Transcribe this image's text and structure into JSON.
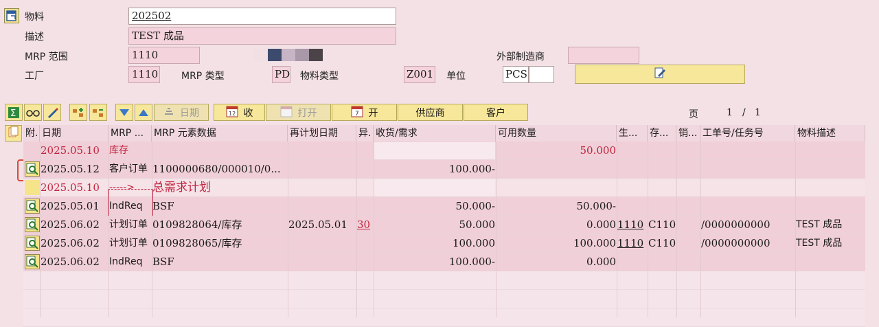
{
  "header": {
    "material_label": "物料",
    "material_value": "202502",
    "desc_label": "描述",
    "desc_value": "TEST 成品",
    "mrp_area_label": "MRP 范围",
    "mrp_area_value": "1110",
    "ext_mfr_label": "外部制造商",
    "ext_mfr_value": "",
    "plant_label": "工厂",
    "plant_value": "1110",
    "mrp_type_label": "MRP 类型",
    "mrp_type_value": "PD",
    "mat_type_label": "物料类型",
    "mat_type_value": "Z001",
    "unit_label": "单位",
    "unit_value": "PCS",
    "unit_extra": ""
  },
  "toolbar": {
    "date_label": "日期",
    "receipt_label": "收",
    "open_label": "打开",
    "open2_label": "开",
    "supplier_label": "供应商",
    "customer_label": "客户",
    "page_label": "页",
    "page_current": "1",
    "page_sep": "/",
    "page_total": "1"
  },
  "grid": {
    "columns": [
      "附.",
      "日期",
      "MRP ...",
      "MRP 元素数据",
      "再计划日期",
      "异.",
      "收货/需求",
      "可用数量",
      "生...",
      "存...",
      "销...",
      "工单号/任务号",
      "物料描述"
    ],
    "rows": [
      {
        "date": "2025.05.10",
        "mrp": "库存",
        "data": "",
        "resched": "",
        "exc": "",
        "qty": "",
        "avail": "50.000",
        "prod": "",
        "stor": "",
        "sales": "",
        "order": "",
        "desc": "",
        "style": "red",
        "icon": false
      },
      {
        "date": "2025.05.12",
        "mrp": "客户订单",
        "data": "1100000680/000010/0...",
        "resched": "",
        "exc": "",
        "qty": "100.000-",
        "avail": "",
        "prod": "",
        "stor": "",
        "sales": "",
        "order": "",
        "desc": "",
        "style": "normal",
        "icon": true
      },
      {
        "date": "2025.05.10",
        "mrp": "----->",
        "data": "总需求计划",
        "resched": "",
        "exc": "",
        "qty": "",
        "avail": "",
        "prod": "",
        "stor": "",
        "sales": "",
        "order": "",
        "desc": "",
        "style": "red",
        "icon": false
      },
      {
        "date": "2025.05.01",
        "mrp": "IndReq",
        "data": "BSF",
        "resched": "",
        "exc": "",
        "qty": "50.000-",
        "avail": "50.000-",
        "prod": "",
        "stor": "",
        "sales": "",
        "order": "",
        "desc": "",
        "style": "normal",
        "icon": true
      },
      {
        "date": "2025.06.02",
        "mrp": "计划订单",
        "data": "0109828064/库存",
        "resched": "2025.05.01",
        "exc": "30",
        "qty": "50.000",
        "avail": "0.000",
        "prod": "1110",
        "stor": "C110",
        "sales": "",
        "order": "/0000000000",
        "desc": "TEST 成品",
        "style": "normal",
        "icon": true
      },
      {
        "date": "2025.06.02",
        "mrp": "计划订单",
        "data": "0109828065/库存",
        "resched": "",
        "exc": "",
        "qty": "100.000",
        "avail": "100.000",
        "prod": "1110",
        "stor": "C110",
        "sales": "",
        "order": "/0000000000",
        "desc": "TEST 成品",
        "style": "normal",
        "icon": true
      },
      {
        "date": "2025.06.02",
        "mrp": "IndReq",
        "data": "BSF",
        "resched": "",
        "exc": "",
        "qty": "100.000-",
        "avail": "0.000",
        "prod": "",
        "stor": "",
        "sales": "",
        "order": "",
        "desc": "",
        "style": "normal",
        "icon": true
      }
    ]
  },
  "colors": {
    "background": "#f3e1e6",
    "button": "#f7e79a",
    "highlight_border": "#d94a3a",
    "red_text": "#c0243e"
  }
}
